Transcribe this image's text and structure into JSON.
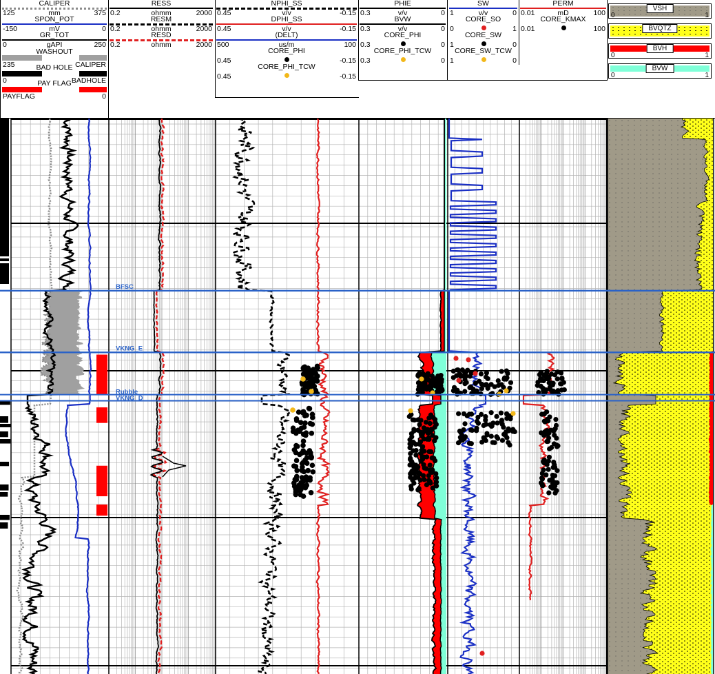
{
  "header": {
    "track1": [
      {
        "name": "CALIPER",
        "lo": "125",
        "unit": "mm",
        "hi": "375",
        "color": "#8c8c8c",
        "style": "dotted"
      },
      {
        "name": "SPON_POT",
        "lo": "-150",
        "unit": "mV",
        "hi": "0",
        "color": "#1a2fc4",
        "style": "solid"
      },
      {
        "name": "GR_TOT",
        "lo": "0",
        "unit": "gAPI",
        "hi": "250",
        "color": "#000000",
        "style": "solid"
      },
      {
        "name": "WASHOUT",
        "lo": "235",
        "unit": "",
        "hi": "CALIPER",
        "color": "#a0a0a0",
        "style": "fill"
      },
      {
        "name": "BAD HOLE",
        "lo": "0",
        "unit": "",
        "hi": "BADHOLE",
        "color": "#000000",
        "style": "fill"
      },
      {
        "name": "PAY FLAG",
        "lo": "PAYFLAG",
        "unit": "",
        "hi": "0",
        "color": "#ff0000",
        "style": "fill"
      }
    ],
    "track2": [
      {
        "name": "RESS",
        "lo": "0.2",
        "unit": "ohmm",
        "hi": "2000",
        "color": "#000000",
        "style": "solid"
      },
      {
        "name": "RESM",
        "lo": "0.2",
        "unit": "ohmm",
        "hi": "2000",
        "color": "#000000",
        "style": "dashed"
      },
      {
        "name": "RESD",
        "lo": "0.2",
        "unit": "ohmm",
        "hi": "2000",
        "color": "#e02020",
        "style": "dashed"
      }
    ],
    "track3": [
      {
        "name": "NPHI_SS",
        "lo": "0.45",
        "unit": "v/v",
        "hi": "-0.15",
        "color": "#000000",
        "style": "dashed"
      },
      {
        "name": "DPHI_SS",
        "lo": "0.45",
        "unit": "v/v",
        "hi": "-0.15",
        "color": "#e02020",
        "style": "solid"
      },
      {
        "name": "(DELT)",
        "lo": "500",
        "unit": "us/m",
        "hi": "100",
        "color": "#1a2fc4",
        "style": "solid"
      },
      {
        "name": "CORE_PHI",
        "lo": "0.45",
        "unit": "",
        "hi": "-0.15",
        "color": "#000000",
        "style": "dot"
      },
      {
        "name": "CORE_PHI_TCW",
        "lo": "0.45",
        "unit": "",
        "hi": "-0.15",
        "color": "#f2b81a",
        "style": "dot"
      }
    ],
    "track4": [
      {
        "name": "PHIE",
        "lo": "0.3",
        "unit": "v/v",
        "hi": "0",
        "color": "#000000",
        "style": "solid"
      },
      {
        "name": "BVW",
        "lo": "0.3",
        "unit": "v/v",
        "hi": "0",
        "color": "#000000",
        "style": "solid"
      },
      {
        "name": "CORE_PHI",
        "lo": "0.3",
        "unit": "",
        "hi": "0",
        "color": "#000000",
        "style": "dot"
      },
      {
        "name": "CORE_PHI_TCW",
        "lo": "0.3",
        "unit": "",
        "hi": "0",
        "color": "#f2b81a",
        "style": "dot"
      }
    ],
    "track5": [
      {
        "name": "SW",
        "lo": "1",
        "unit": "v/v",
        "hi": "0",
        "color": "#1a2fc4",
        "style": "solid"
      },
      {
        "name": "CORE_SO",
        "lo": "0",
        "unit": "",
        "hi": "1",
        "color": "#e02020",
        "style": "dot"
      },
      {
        "name": "CORE_SW",
        "lo": "1",
        "unit": "",
        "hi": "0",
        "color": "#000000",
        "style": "dot"
      },
      {
        "name": "CORE_SW_TCW",
        "lo": "1",
        "unit": "",
        "hi": "0",
        "color": "#f2b81a",
        "style": "dot"
      }
    ],
    "track6": [
      {
        "name": "PERM",
        "lo": "0.01",
        "unit": "mD",
        "hi": "100",
        "color": "#e02020",
        "style": "solid"
      },
      {
        "name": "CORE_KMAX",
        "lo": "0.01",
        "unit": "",
        "hi": "100",
        "color": "#000000",
        "style": "dot"
      }
    ],
    "lith": [
      {
        "name": "VSH",
        "lo": "0",
        "hi": "1",
        "color": "#a09a88"
      },
      {
        "name": "BVQTZ",
        "lo": "",
        "hi": "",
        "color": "#ffff1a"
      },
      {
        "name": "BVH",
        "lo": "0",
        "hi": "1",
        "color": "#ff0000"
      },
      {
        "name": "BVW",
        "lo": "0",
        "hi": "1",
        "color": "#7fffd8"
      }
    ]
  },
  "tops": [
    {
      "name": "BFSC"
    },
    {
      "name": "VKNG_E"
    },
    {
      "name": "Rubble"
    },
    {
      "name": "VKNG_D"
    }
  ],
  "colors": {
    "grid": "#b4b4b4",
    "major": "#000000",
    "tops": "#2a62c8",
    "red": "#e02020",
    "blue": "#1a2fc4",
    "gray": "#a0a0a0",
    "yellow": "#ffff1a",
    "cyan": "#7fffd8",
    "shale": "#a09a88",
    "orange": "#f2b81a"
  },
  "chart_data": {
    "type": "line",
    "title": "",
    "depth_axis": {
      "direction": "down",
      "relative_range": [
        0,
        1
      ]
    },
    "tops": [
      {
        "name": "BFSC",
        "relative_depth": 0.31
      },
      {
        "name": "VKNG_E",
        "relative_depth": 0.421
      },
      {
        "name": "Rubble",
        "relative_depth": 0.497
      },
      {
        "name": "VKNG_D",
        "relative_depth": 0.508
      }
    ],
    "tracks": [
      {
        "track": 1,
        "curves": [
          "CALIPER",
          "SPON_POT",
          "GR_TOT",
          "WASHOUT",
          "BAD HOLE",
          "PAY FLAG"
        ],
        "pay_flag_intervals_relative": [
          [
            0.425,
            0.498
          ],
          [
            0.52,
            0.548
          ],
          [
            0.625,
            0.68
          ],
          [
            0.695,
            0.715
          ]
        ]
      },
      {
        "track": 2,
        "curves": [
          "RESS",
          "RESM",
          "RESD"
        ],
        "scale": "log",
        "range": [
          0.2,
          2000
        ]
      },
      {
        "track": 3,
        "curves": [
          "NPHI_SS",
          "DPHI_SS",
          "CORE_PHI",
          "CORE_PHI_TCW"
        ],
        "range": [
          0.45,
          -0.15
        ]
      },
      {
        "track": 4,
        "curves": [
          "PHIE",
          "BVW",
          "CORE_PHI",
          "CORE_PHI_TCW"
        ],
        "range": [
          0.3,
          0
        ]
      },
      {
        "track": 5,
        "curves": [
          "SW",
          "CORE_SO",
          "CORE_SW",
          "CORE_SW_TCW"
        ],
        "range": [
          1,
          0
        ]
      },
      {
        "track": 6,
        "curves": [
          "PERM",
          "CORE_KMAX"
        ],
        "scale": "log",
        "range": [
          0.01,
          100
        ]
      },
      {
        "track": 7,
        "curves": [
          "VSH",
          "BVQTZ",
          "BVH",
          "BVW"
        ],
        "range": [
          0,
          1
        ]
      }
    ]
  }
}
